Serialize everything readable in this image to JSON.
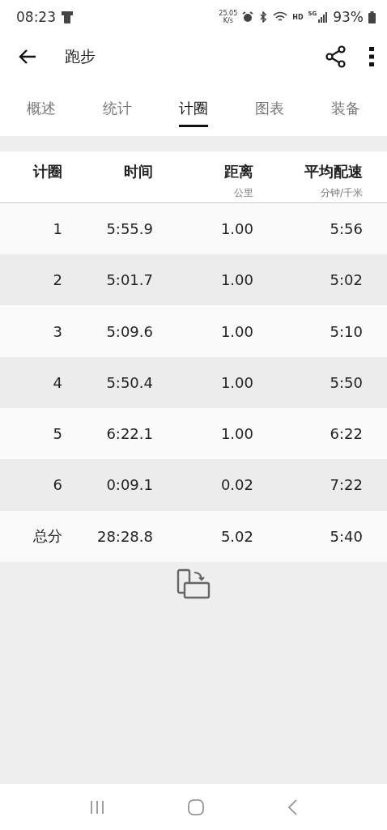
{
  "status_bar": {
    "time": "08:23",
    "speed_value": "25.05",
    "speed_unit": "K/s",
    "hd": "HD",
    "network": "5G",
    "battery": "93%"
  },
  "toolbar": {
    "title": "跑步"
  },
  "tabs": [
    {
      "label": "概述",
      "selected": false
    },
    {
      "label": "统计",
      "selected": false
    },
    {
      "label": "计圈",
      "selected": true
    },
    {
      "label": "图表",
      "selected": false
    },
    {
      "label": "装备",
      "selected": false
    }
  ],
  "table": {
    "columns": [
      {
        "label": "计圈"
      },
      {
        "label": "时间"
      },
      {
        "label": "距离",
        "unit": "公里"
      },
      {
        "label": "平均配速",
        "unit": "分钟/千米"
      }
    ],
    "rows": [
      [
        "1",
        "5:55.9",
        "1.00",
        "5:56"
      ],
      [
        "2",
        "5:01.7",
        "1.00",
        "5:02"
      ],
      [
        "3",
        "5:09.6",
        "1.00",
        "5:10"
      ],
      [
        "4",
        "5:50.4",
        "1.00",
        "5:50"
      ],
      [
        "5",
        "6:22.1",
        "1.00",
        "6:22"
      ],
      [
        "6",
        "0:09.1",
        "0.02",
        "7:22"
      ]
    ],
    "total": [
      "总分",
      "28:28.8",
      "5.02",
      "5:40"
    ]
  }
}
